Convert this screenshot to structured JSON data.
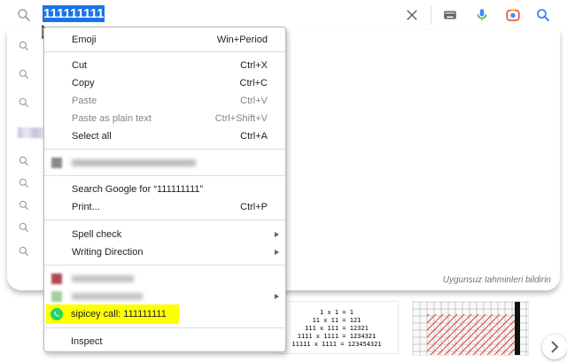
{
  "search": {
    "query": "111111111",
    "clear_icon": "close-icon",
    "keyboard_icon": "keyboard-icon",
    "voice_icon": "microphone-icon",
    "lens_icon": "camera-lens-icon",
    "search_icon": "search-icon"
  },
  "suggestions": {
    "report_link": "Uygunsuz tahminleri bildirin"
  },
  "context_menu": {
    "emoji": {
      "label": "Emoji",
      "shortcut": "Win+Period"
    },
    "cut": {
      "label": "Cut",
      "shortcut": "Ctrl+X"
    },
    "copy": {
      "label": "Copy",
      "shortcut": "Ctrl+C"
    },
    "paste": {
      "label": "Paste",
      "shortcut": "Ctrl+V"
    },
    "paste_plain": {
      "label": "Paste as plain text",
      "shortcut": "Ctrl+Shift+V"
    },
    "select_all": {
      "label": "Select all",
      "shortcut": "Ctrl+A"
    },
    "search_google": {
      "label": "Search Google for “111111111”"
    },
    "print": {
      "label": "Print...",
      "shortcut": "Ctrl+P"
    },
    "spell_check": {
      "label": "Spell check"
    },
    "writing_direction": {
      "label": "Writing Direction"
    },
    "sipicey": {
      "label": "sipicey call: 111111111"
    },
    "inspect": {
      "label": "Inspect"
    }
  },
  "images": {
    "formula_lines": [
      "1 x 1 = 1",
      "11 x 11 = 121",
      "111 x 111 = 12321",
      "1111 x 1111 = 1234321",
      "11111 x 1111 = 123454321"
    ]
  },
  "colors": {
    "selection": "#1a73e8",
    "highlight": "#ffff00",
    "whatsapp_green": "#25d366"
  }
}
